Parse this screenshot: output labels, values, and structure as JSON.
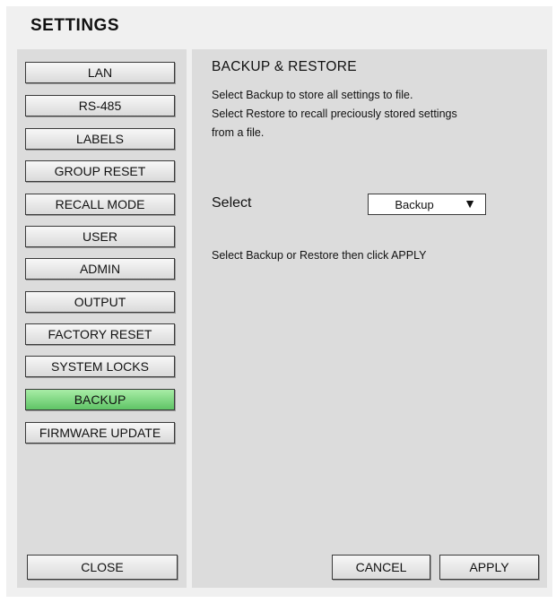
{
  "window": {
    "title": "SETTINGS"
  },
  "sidebar": {
    "items": [
      {
        "label": "LAN"
      },
      {
        "label": "RS-485"
      },
      {
        "label": "LABELS"
      },
      {
        "label": "GROUP RESET"
      },
      {
        "label": "RECALL MODE"
      },
      {
        "label": "USER"
      },
      {
        "label": "ADMIN"
      },
      {
        "label": "OUTPUT"
      },
      {
        "label": "FACTORY RESET"
      },
      {
        "label": "SYSTEM LOCKS"
      },
      {
        "label": "BACKUP"
      },
      {
        "label": "FIRMWARE UPDATE"
      }
    ],
    "active_item": "BACKUP",
    "close_label": "CLOSE"
  },
  "main": {
    "heading": "BACKUP & RESTORE",
    "description_lines": [
      "Select Backup to store all settings to file.",
      "Select Restore to recall preciously stored settings",
      "from a file."
    ],
    "select_label": "Select",
    "select_value": "Backup",
    "hint": "Select Backup or Restore then click APPLY",
    "cancel_label": "CANCEL",
    "apply_label": "APPLY"
  },
  "colors": {
    "active_button": "#5fc466",
    "panel_bg": "#dcdcdc"
  }
}
